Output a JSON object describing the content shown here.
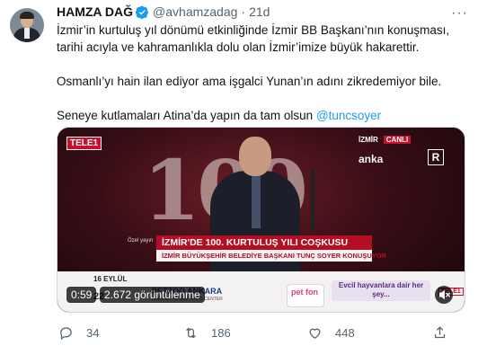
{
  "tweet": {
    "author_name": "HAMZA DAĞ",
    "handle": "@avhamzadag",
    "separator": "·",
    "time": "21d",
    "more_icon": "more-icon",
    "lines": [
      "İzmir’in kurtuluş yıl dönümü etkinliğinde İzmir BB Başkanı’nın konuşması,",
      "tarihi acıyla ve kahramanlıkla dolu olan İzmir’imize büyük hakarettir.",
      "Osmanlı’yı hain ilan ediyor ama işgalci Yunan’ın adını zikredemiyor bile."
    ],
    "last_line_text": "Seneye kutlamaları Atina’da yapın da tam olsun ",
    "mention": "@tuncsoyer",
    "colors": {
      "link": "#1d9bf0",
      "verified": "#1d9bf0",
      "muted": "#536471"
    }
  },
  "video": {
    "duration": "0:59",
    "views": "2.672 görüntülenme",
    "channel_logo": "TELE1",
    "live_label_city": "İZMİR",
    "live_label": "CANLI",
    "agency": "anka",
    "rating": "R",
    "big_overlay": "100",
    "lower_third_title": "İZMİR'DE 100. KURTULUŞ YILI COŞKUSU",
    "lower_third_subtitle": "İZMİR BÜYÜKŞEHİR BELEDİYE BAŞKANI TUNÇ SOYER KONUŞUYOR",
    "side_label": "Özel yayın",
    "ticker_date": "16 EYLÜL",
    "ticker_date2": "22",
    "ticker_sponsor": "PETZOO ANKARA",
    "ticker_sponsor_sub": "ANKA ALTINPARK EXPO CENTER",
    "ticker_brand": "pet fon",
    "ticker_promo": "Evcil hayvanlara dair her şey...",
    "ticker_channel": "TELE1"
  },
  "actions": {
    "replies": "34",
    "retweets": "186",
    "likes": "448"
  }
}
